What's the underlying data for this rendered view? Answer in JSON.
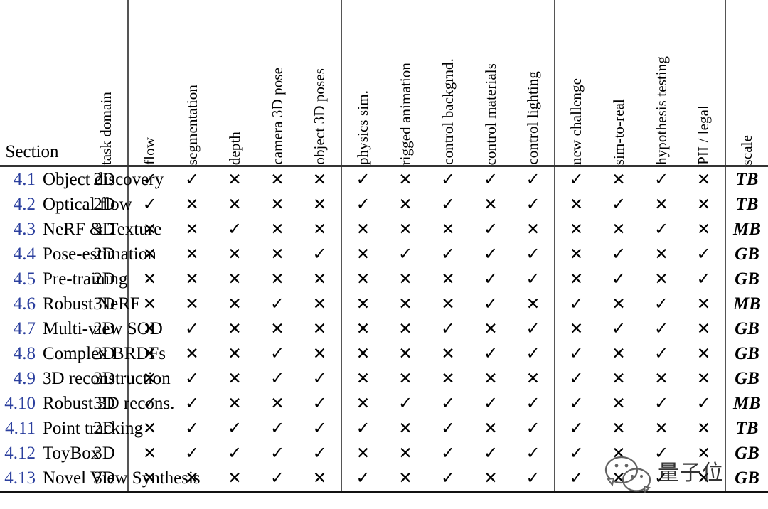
{
  "table": {
    "section_header": "Section",
    "column_groups": [
      {
        "name": "domain-group",
        "columns": [
          "task domain"
        ]
      },
      {
        "name": "annotations-group",
        "columns": [
          "flow",
          "segmentation",
          "depth",
          "camera 3D pose",
          "object 3D poses"
        ]
      },
      {
        "name": "controls-group",
        "columns": [
          "physics sim.",
          "rigged animation",
          "control backgrnd.",
          "control materials",
          "control lighting"
        ]
      },
      {
        "name": "properties-group",
        "columns": [
          "new challenge",
          "sim-to-real",
          "hypothesis testing",
          "PII / legal"
        ]
      },
      {
        "name": "scale-group",
        "columns": [
          "scale"
        ]
      }
    ],
    "columns": [
      "task domain",
      "flow",
      "segmentation",
      "depth",
      "camera 3D pose",
      "object 3D poses",
      "physics sim.",
      "rigged animation",
      "control backgrnd.",
      "control materials",
      "control lighting",
      "new challenge",
      "sim-to-real",
      "hypothesis testing",
      "PII / legal",
      "scale"
    ],
    "marks": {
      "yes": "✓",
      "no": "✕"
    },
    "link_color": "#2b3f9e",
    "rows": [
      {
        "number": "4.1",
        "name": "Object discovery",
        "domain": "2D",
        "scale": "TB",
        "values": [
          true,
          true,
          false,
          false,
          false,
          true,
          false,
          true,
          true,
          true,
          true,
          false,
          true,
          false
        ]
      },
      {
        "number": "4.2",
        "name": "Optical flow",
        "domain": "2D",
        "scale": "TB",
        "values": [
          true,
          false,
          false,
          false,
          false,
          true,
          false,
          true,
          false,
          true,
          false,
          true,
          false,
          false
        ]
      },
      {
        "number": "4.3",
        "name": "NeRF & Texture",
        "domain": "3D",
        "scale": "MB",
        "values": [
          false,
          false,
          true,
          false,
          false,
          false,
          false,
          false,
          true,
          false,
          false,
          false,
          true,
          false
        ]
      },
      {
        "number": "4.4",
        "name": "Pose-estimation",
        "domain": "2D",
        "scale": "GB",
        "values": [
          false,
          false,
          false,
          false,
          true,
          false,
          true,
          true,
          true,
          true,
          false,
          true,
          false,
          true
        ]
      },
      {
        "number": "4.5",
        "name": "Pre-training",
        "domain": "2D",
        "scale": "GB",
        "values": [
          false,
          false,
          false,
          false,
          false,
          false,
          false,
          false,
          true,
          true,
          false,
          true,
          false,
          true
        ]
      },
      {
        "number": "4.6",
        "name": "Robust NeRF",
        "domain": "3D",
        "scale": "MB",
        "values": [
          false,
          false,
          false,
          true,
          false,
          false,
          false,
          false,
          true,
          false,
          true,
          false,
          true,
          false
        ]
      },
      {
        "number": "4.7",
        "name": "Multi-view SOD",
        "domain": "2D",
        "scale": "GB",
        "values": [
          false,
          true,
          false,
          false,
          false,
          false,
          false,
          true,
          false,
          true,
          false,
          true,
          true,
          false
        ]
      },
      {
        "number": "4.8",
        "name": "Complex BRDFs",
        "domain": "3D",
        "scale": "GB",
        "values": [
          false,
          false,
          false,
          true,
          false,
          false,
          false,
          false,
          true,
          true,
          true,
          false,
          true,
          false
        ]
      },
      {
        "number": "4.9",
        "name": "3D reconstruction",
        "domain": "3D",
        "scale": "GB",
        "values": [
          false,
          true,
          false,
          true,
          true,
          false,
          false,
          false,
          false,
          false,
          true,
          false,
          false,
          false
        ]
      },
      {
        "number": "4.10",
        "name": "Robust 3D recons.",
        "domain": "3D",
        "scale": "MB",
        "values": [
          true,
          true,
          false,
          false,
          true,
          false,
          true,
          true,
          true,
          true,
          true,
          false,
          true,
          true
        ]
      },
      {
        "number": "4.11",
        "name": "Point tracking",
        "domain": "2D",
        "scale": "TB",
        "values": [
          false,
          true,
          true,
          true,
          true,
          true,
          false,
          true,
          false,
          true,
          true,
          false,
          false,
          false
        ]
      },
      {
        "number": "4.12",
        "name": "ToyBox",
        "domain": "3D",
        "scale": "GB",
        "values": [
          false,
          true,
          true,
          true,
          true,
          false,
          false,
          true,
          true,
          true,
          true,
          false,
          true,
          false
        ]
      },
      {
        "number": "4.13",
        "name": "Novel View Synthesis",
        "domain": "3D",
        "scale": "GB",
        "values": [
          false,
          false,
          false,
          true,
          false,
          true,
          false,
          true,
          false,
          true,
          true,
          false,
          true,
          false
        ]
      }
    ]
  },
  "watermark": {
    "text": "量子位",
    "icon": "wechat-icon"
  }
}
